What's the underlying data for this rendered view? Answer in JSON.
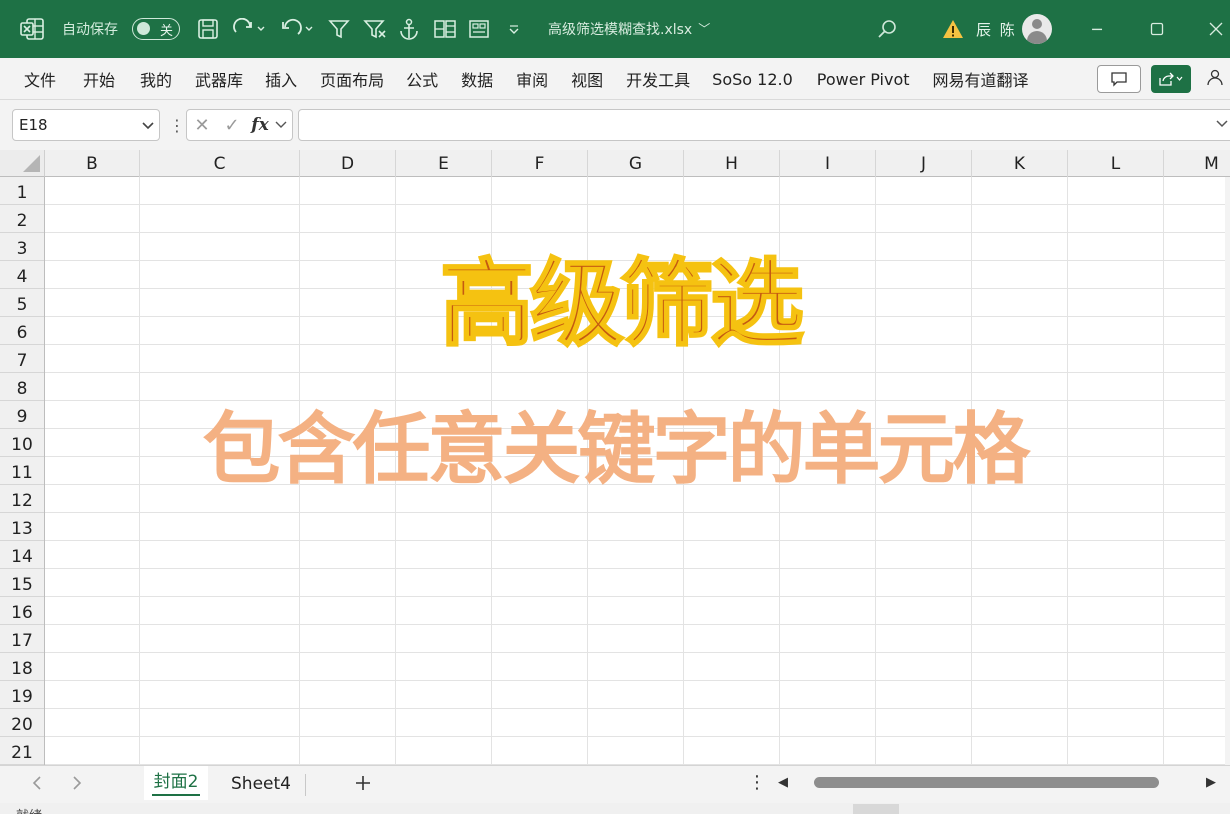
{
  "titlebar": {
    "autosave_label": "自动保存",
    "autosave_state": "关",
    "doc_title": "高级筛选模糊查找.xlsx",
    "user_name": "辰 陈",
    "icons": [
      "excel-logo-icon",
      "save-icon",
      "redo-icon",
      "undo-icon",
      "filter-icon",
      "clear-filter-icon",
      "anchor-icon",
      "cell-style-icon",
      "form-icon",
      "customize-qat-icon",
      "search-icon",
      "warning-icon",
      "minimize-icon",
      "maximize-icon",
      "close-icon"
    ]
  },
  "ribbon": {
    "tabs": [
      "文件",
      "开始",
      "我的",
      "武器库",
      "插入",
      "页面布局",
      "公式",
      "数据",
      "审阅",
      "视图",
      "开发工具",
      "SoSo 12.0",
      "Power Pivot",
      "网易有道翻译"
    ]
  },
  "formulabar": {
    "namebox": "E18",
    "formula": ""
  },
  "grid": {
    "columns": [
      "B",
      "C",
      "D",
      "E",
      "F",
      "G",
      "H",
      "I",
      "J",
      "K",
      "L",
      "M"
    ],
    "rows": [
      "1",
      "2",
      "3",
      "4",
      "5",
      "6",
      "7",
      "8",
      "9",
      "10",
      "11",
      "12",
      "13",
      "14",
      "15",
      "16",
      "17",
      "18",
      "19",
      "20",
      "21"
    ]
  },
  "artwork": {
    "title": "高级筛选",
    "subtitle": "包含任意关键字的单元格",
    "title_fill": "#c55a11",
    "title_outline": "#f5c211",
    "subtitle_fill": "#f4b183"
  },
  "sheets": {
    "tabs": [
      "封面2",
      "Sheet4"
    ],
    "active": "封面2"
  },
  "statusbar": {
    "text": "就绪"
  },
  "colors": {
    "accent": "#1e7145",
    "ribbon_bg": "#f3f3f3",
    "gridline": "#e3e3e3"
  }
}
